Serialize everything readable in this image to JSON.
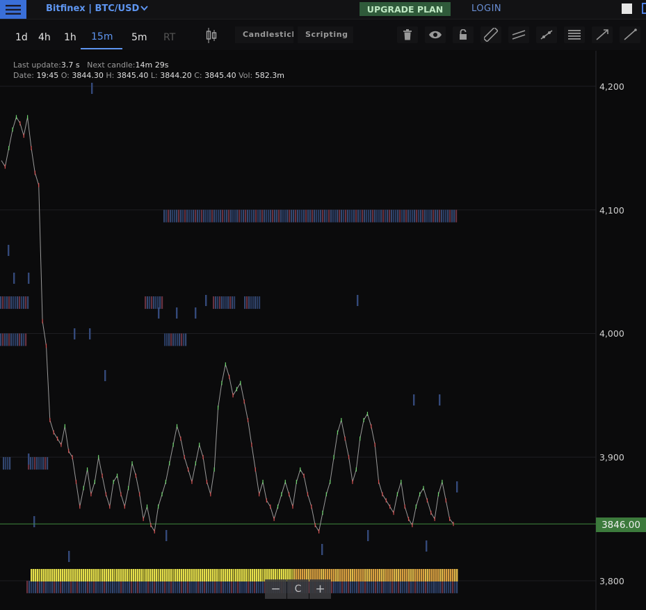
{
  "header": {
    "menu_icon": "hamburger-icon",
    "pair_label": "Bitfinex | BTC/USD",
    "pair_chevron": "chevron-down-icon",
    "upgrade_label": "UPGRADE PLAN",
    "login_label": "LOGIN"
  },
  "toolbar": {
    "timeframes": [
      "1d",
      "4h",
      "1h",
      "15m",
      "5m",
      "RT"
    ],
    "active_timeframe": "15m",
    "chart_type_label": "Candlestick",
    "scripting_label": "Scripting",
    "tool_icons": [
      "trash-icon",
      "eye-icon",
      "lock-icon",
      "ruler-icon",
      "parallel-lines-icon",
      "trendline-icon",
      "horizontal-lines-icon",
      "ray-icon",
      "line-icon"
    ]
  },
  "info": {
    "last_update_label": "Last update:",
    "last_update_value": "3.7 s",
    "next_candle_label": "Next candle:",
    "next_candle_value": "14m 29s",
    "date_label": "Date:",
    "date_value": "19:45",
    "o_label": "O:",
    "o_value": "3844.30",
    "h_label": "H:",
    "h_value": "3845.40",
    "l_label": "L:",
    "l_value": "3844.20",
    "c_label": "C:",
    "c_value": "3845.40",
    "vol_label": "Vol:",
    "vol_value": "582.3m"
  },
  "price_axis": {
    "ticks": [
      "4,200",
      "4,100",
      "4,000",
      "3,900",
      "3,800"
    ],
    "current_price": "3846.00"
  },
  "zoom": {
    "minus": "−",
    "reset": "C",
    "plus": "+"
  },
  "colors": {
    "accent": "#5e95f0",
    "upgrade_bg": "#2f5a3a",
    "price_tag": "#3c7a3c",
    "orderbook_blue": "#3a4f7a",
    "orderbook_yellow": "#e8e04a"
  },
  "chart_data": {
    "type": "line",
    "ylim": [
      3775,
      4230
    ],
    "yticks": [
      4200,
      4100,
      4000,
      3900,
      3800
    ],
    "current_price": 3846.0,
    "series": [
      {
        "values": [
          4140,
          4135,
          4150,
          4165,
          4175,
          4170,
          4160,
          4175,
          4150,
          4130,
          4120,
          4010,
          3990,
          3930,
          3920,
          3915,
          3910,
          3925,
          3905,
          3900,
          3880,
          3860,
          3875,
          3890,
          3870,
          3880,
          3900,
          3885,
          3870,
          3860,
          3880,
          3885,
          3870,
          3860,
          3875,
          3895,
          3885,
          3870,
          3850,
          3860,
          3845,
          3840,
          3860,
          3870,
          3880,
          3895,
          3910,
          3925,
          3915,
          3900,
          3890,
          3880,
          3895,
          3910,
          3900,
          3880,
          3870,
          3890,
          3940,
          3960,
          3975,
          3965,
          3950,
          3955,
          3960,
          3945,
          3930,
          3910,
          3890,
          3870,
          3880,
          3865,
          3860,
          3850,
          3860,
          3870,
          3880,
          3870,
          3860,
          3880,
          3890,
          3885,
          3870,
          3860,
          3845,
          3840,
          3855,
          3870,
          3880,
          3900,
          3920,
          3930,
          3915,
          3900,
          3880,
          3890,
          3915,
          3930,
          3935,
          3925,
          3910,
          3880,
          3870,
          3865,
          3860,
          3855,
          3870,
          3880,
          3860,
          3850,
          3845,
          3860,
          3870,
          3875,
          3865,
          3855,
          3850,
          3870,
          3880,
          3865,
          3850,
          3846
        ]
      }
    ],
    "orderbook_bands": [
      {
        "price": 4095,
        "color": "blue"
      },
      {
        "price": 4025,
        "color": "blue"
      },
      {
        "price": 3995,
        "color": "blue"
      },
      {
        "price": 3895,
        "color": "blue"
      },
      {
        "price": 3805,
        "color": "yellow"
      },
      {
        "price": 3795,
        "color": "blue"
      }
    ]
  }
}
